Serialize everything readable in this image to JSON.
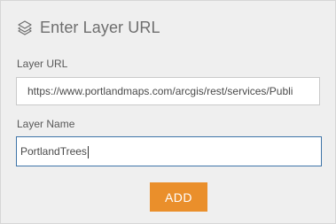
{
  "header": {
    "title": "Enter Layer URL",
    "icon": "layers-icon"
  },
  "form": {
    "url_label": "Layer URL",
    "url_value": "https://www.portlandmaps.com/arcgis/rest/services/Publi",
    "name_label": "Layer Name",
    "name_value": "PortlandTrees",
    "add_label": "ADD"
  },
  "colors": {
    "panel_bg": "#efefef",
    "accent_button": "#ea8f2b",
    "focus_border": "#3f74a8"
  }
}
